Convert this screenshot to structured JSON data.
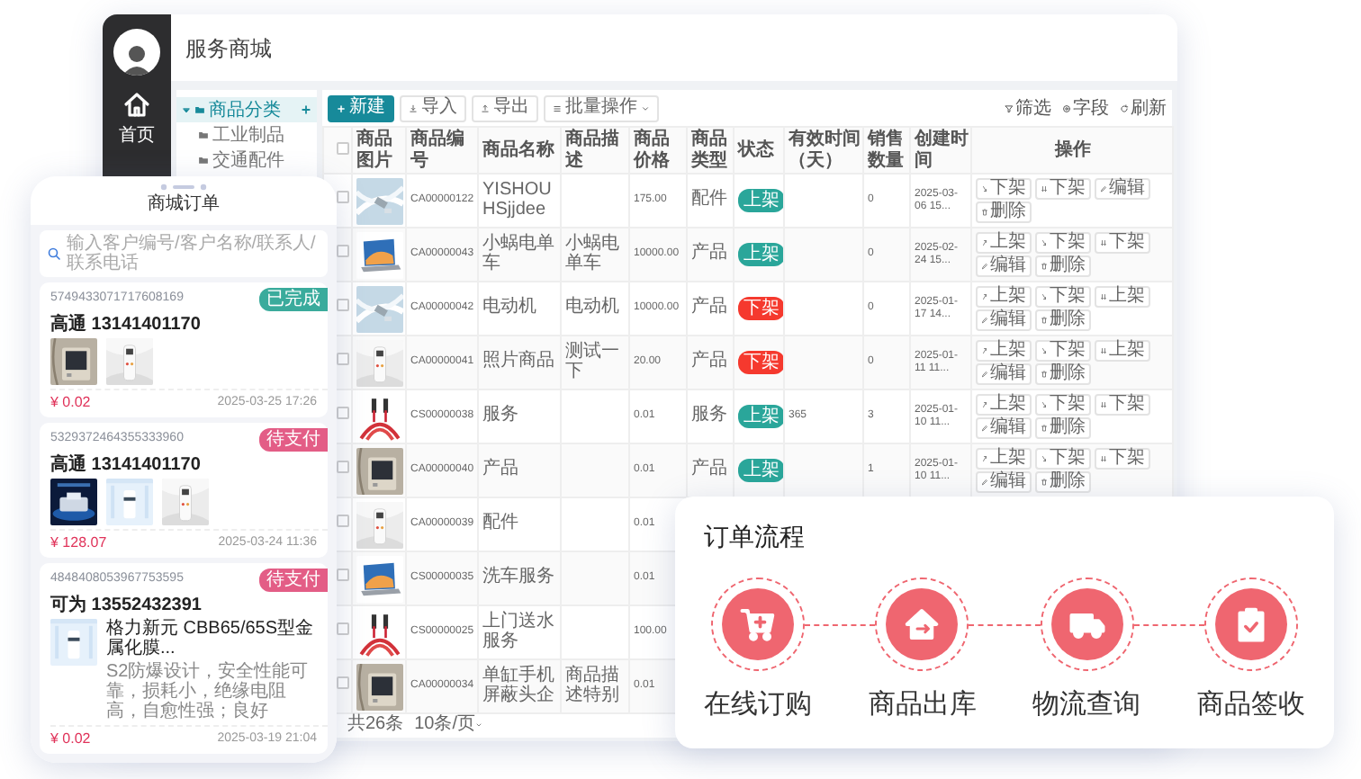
{
  "admin": {
    "title": "服务商城",
    "nav": [
      {
        "label": "首页",
        "kind": "home"
      }
    ],
    "tree": [
      {
        "label": "商品分类",
        "expanded": true,
        "selected": true,
        "children": [
          {
            "label": "工业制品",
            "selected": false
          },
          {
            "label": "交通配件",
            "selected": false
          }
        ]
      }
    ],
    "toolbar": {
      "left": [
        {
          "label": "新建",
          "kind": "primary"
        },
        {
          "label": "导入",
          "kind": "import"
        },
        {
          "label": "导出",
          "kind": "export"
        },
        {
          "label": "批量操作",
          "kind": "menu"
        }
      ],
      "right": [
        {
          "label": "筛选",
          "kind": "filter"
        },
        {
          "label": "字段",
          "kind": "field"
        },
        {
          "label": "刷新",
          "kind": "refresh"
        }
      ]
    },
    "table": {
      "select_all_checked": false,
      "columns": [
        "商品图片",
        "商品编号",
        "商品名称",
        "商品描述",
        "商品价格",
        "商品类型",
        "状态",
        "有效时间（天）",
        "销售数量",
        "创建时间",
        "操作"
      ],
      "rows": [
        {
          "checked": false,
          "image": {
            "kind": "picture"
          },
          "code": "CA00000122",
          "name": "YISHOUHSjjdee",
          "price": "175.00",
          "type": "配件",
          "status": {
            "label": "上架",
            "listed": true
          },
          "sales": "0",
          "created": "2025-03-06 15...",
          "ops": [
            {
              "label": "下架",
              "kind": "down"
            },
            {
              "label": "下架",
              "kind": "double"
            },
            {
              "label": "编辑",
              "kind": "edit"
            },
            {
              "label": "删除",
              "kind": "delete"
            }
          ]
        },
        {
          "checked": false,
          "image": {
            "kind": "picture"
          },
          "code": "CA00000043",
          "name": "小蜗电单车",
          "description": "小蜗电单车",
          "price": "10000.00",
          "type": "产品",
          "status": {
            "label": "上架",
            "listed": true
          },
          "sales": "0",
          "created": "2025-02-24 15...",
          "ops": [
            {
              "label": "上架",
              "kind": "up"
            },
            {
              "label": "下架",
              "kind": "down"
            },
            {
              "label": "下架",
              "kind": "double"
            },
            {
              "label": "编辑",
              "kind": "edit"
            },
            {
              "label": "删除",
              "kind": "delete"
            }
          ]
        },
        {
          "checked": false,
          "image": {
            "kind": "picture"
          },
          "code": "CA00000042",
          "name": "电动机",
          "description": "电动机",
          "price": "10000.00",
          "type": "产品",
          "status": {
            "label": "下架",
            "listed": false
          },
          "sales": "0",
          "created": "2025-01-17 14...",
          "ops": [
            {
              "label": "上架",
              "kind": "up"
            },
            {
              "label": "下架",
              "kind": "down"
            },
            {
              "label": "上架",
              "kind": "double"
            },
            {
              "label": "编辑",
              "kind": "edit"
            },
            {
              "label": "删除",
              "kind": "delete"
            }
          ]
        },
        {
          "checked": false,
          "image": {
            "kind": "picture"
          },
          "code": "CA00000041",
          "name": "照片商品",
          "description": "测试一下",
          "price": "20.00",
          "type": "产品",
          "status": {
            "label": "下架",
            "listed": false
          },
          "sales": "0",
          "created": "2025-01-11 11...",
          "ops": [
            {
              "label": "上架",
              "kind": "up"
            },
            {
              "label": "下架",
              "kind": "down"
            },
            {
              "label": "上架",
              "kind": "double"
            },
            {
              "label": "编辑",
              "kind": "edit"
            },
            {
              "label": "删除",
              "kind": "delete"
            }
          ]
        },
        {
          "checked": false,
          "image": {
            "kind": "picture"
          },
          "code": "CS00000038",
          "name": "服务",
          "price": "0.01",
          "type": "服务",
          "status": {
            "label": "上架",
            "listed": true
          },
          "validity": "365",
          "sales": "3",
          "created": "2025-01-10 11...",
          "ops": [
            {
              "label": "上架",
              "kind": "up"
            },
            {
              "label": "下架",
              "kind": "down"
            },
            {
              "label": "下架",
              "kind": "double"
            },
            {
              "label": "编辑",
              "kind": "edit"
            },
            {
              "label": "删除",
              "kind": "delete"
            }
          ]
        },
        {
          "checked": false,
          "image": {
            "kind": "picture"
          },
          "code": "CA00000040",
          "name": "产品",
          "price": "0.01",
          "type": "产品",
          "status": {
            "label": "上架",
            "listed": true
          },
          "sales": "1",
          "created": "2025-01-10 11...",
          "ops": [
            {
              "label": "上架",
              "kind": "up"
            },
            {
              "label": "下架",
              "kind": "down"
            },
            {
              "label": "下架",
              "kind": "double"
            },
            {
              "label": "编辑",
              "kind": "edit"
            },
            {
              "label": "删除",
              "kind": "delete"
            }
          ]
        },
        {
          "checked": false,
          "image": {
            "kind": "picture"
          },
          "code": "CA00000039",
          "name": "配件",
          "price": "0.01"
        },
        {
          "checked": false,
          "image": {
            "kind": "picture"
          },
          "code": "CS00000035",
          "name": "洗车服务",
          "price": "0.01"
        },
        {
          "checked": false,
          "image": {
            "kind": "picture"
          },
          "code": "CS00000025",
          "name": "上门送水服务",
          "price": "100.00"
        },
        {
          "checked": false,
          "image": {
            "kind": "picture"
          },
          "code": "CA00000034",
          "name": "单缸手机屏蔽头企",
          "description": "商品描述特别",
          "price": "0.01"
        }
      ]
    },
    "footer": {
      "total": "共26条",
      "page_size": "10条/页"
    }
  },
  "mobile": {
    "title": "商城订单",
    "search": {
      "placeholder": "输入客户编号/客户名称/联系人/联系电话"
    },
    "orders": [
      {
        "number": "5749433071717608169",
        "status": {
          "label": "已完成",
          "kind": "done"
        },
        "contact": "高通  13141401170",
        "images": [
          {
            "kind": "picture"
          },
          {
            "kind": "picture"
          }
        ],
        "price": "¥ 0.02",
        "time": "2025-03-25 17:26"
      },
      {
        "number": "5329372464355333960",
        "status": {
          "label": "待支付",
          "kind": "pending"
        },
        "contact": "高通  13141401170",
        "images": [
          {
            "kind": "picture"
          },
          {
            "kind": "picture"
          },
          {
            "kind": "picture"
          }
        ],
        "price": "¥ 128.07",
        "time": "2025-03-24 11:36"
      },
      {
        "number": "4848408053967753595",
        "status": {
          "label": "待支付",
          "kind": "pending"
        },
        "contact": "可为  13552432391",
        "images": [
          {
            "kind": "picture"
          }
        ],
        "product": {
          "title": "格力新元 CBB65/65S型金属化膜...",
          "description": "S2防爆设计，安全性能可靠，损耗小，绝缘电阻高，自愈性强；良好"
        },
        "price": "¥ 0.02",
        "time": "2025-03-19 21:04"
      }
    ]
  },
  "flow": {
    "title": "订单流程",
    "steps": [
      {
        "label": "在线订购",
        "kind": "cart"
      },
      {
        "label": "商品出库",
        "kind": "warehouse"
      },
      {
        "label": "物流查询",
        "kind": "truck"
      },
      {
        "label": "商品签收",
        "kind": "clipboard"
      }
    ]
  }
}
